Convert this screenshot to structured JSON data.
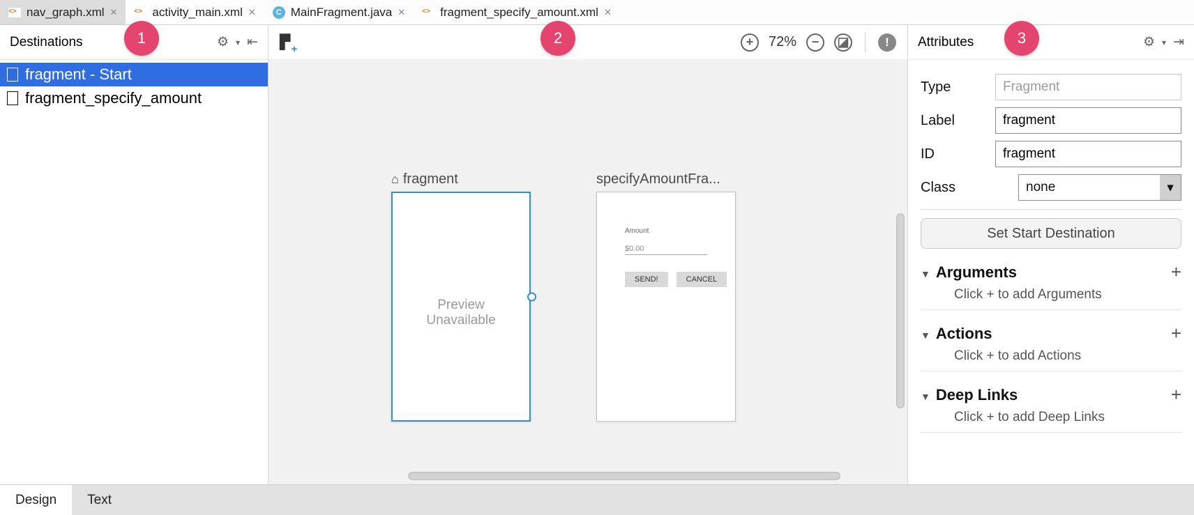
{
  "tabs": [
    {
      "label": "nav_graph.xml",
      "icon": "xml",
      "active": true
    },
    {
      "label": "activity_main.xml",
      "icon": "xml",
      "active": false
    },
    {
      "label": "MainFragment.java",
      "icon": "class",
      "active": false
    },
    {
      "label": "fragment_specify_amount.xml",
      "icon": "xml",
      "active": false
    }
  ],
  "callouts": [
    "1",
    "2",
    "3"
  ],
  "destinations": {
    "title": "Destinations",
    "items": [
      {
        "label": "fragment - Start",
        "selected": true
      },
      {
        "label": "fragment_specify_amount",
        "selected": false
      }
    ]
  },
  "canvas": {
    "zoom": "72%",
    "frag1": {
      "title": "fragment",
      "preview_line1": "Preview",
      "preview_line2": "Unavailable"
    },
    "frag2": {
      "title": "specifyAmountFra...",
      "amount_label": "Amount",
      "amount_value": "$0.00",
      "send": "SEND!",
      "cancel": "CANCEL"
    }
  },
  "attributes": {
    "title": "Attributes",
    "rows": {
      "type_label": "Type",
      "type_value": "Fragment",
      "label_label": "Label",
      "label_value": "fragment",
      "id_label": "ID",
      "id_value": "fragment",
      "class_label": "Class",
      "class_value": "none"
    },
    "start_btn": "Set Start Destination",
    "sections": {
      "args": {
        "title": "Arguments",
        "hint": "Click + to add Arguments"
      },
      "actions": {
        "title": "Actions",
        "hint": "Click + to add Actions"
      },
      "deeplinks": {
        "title": "Deep Links",
        "hint": "Click + to add Deep Links"
      }
    }
  },
  "bottom": {
    "design": "Design",
    "text": "Text"
  }
}
